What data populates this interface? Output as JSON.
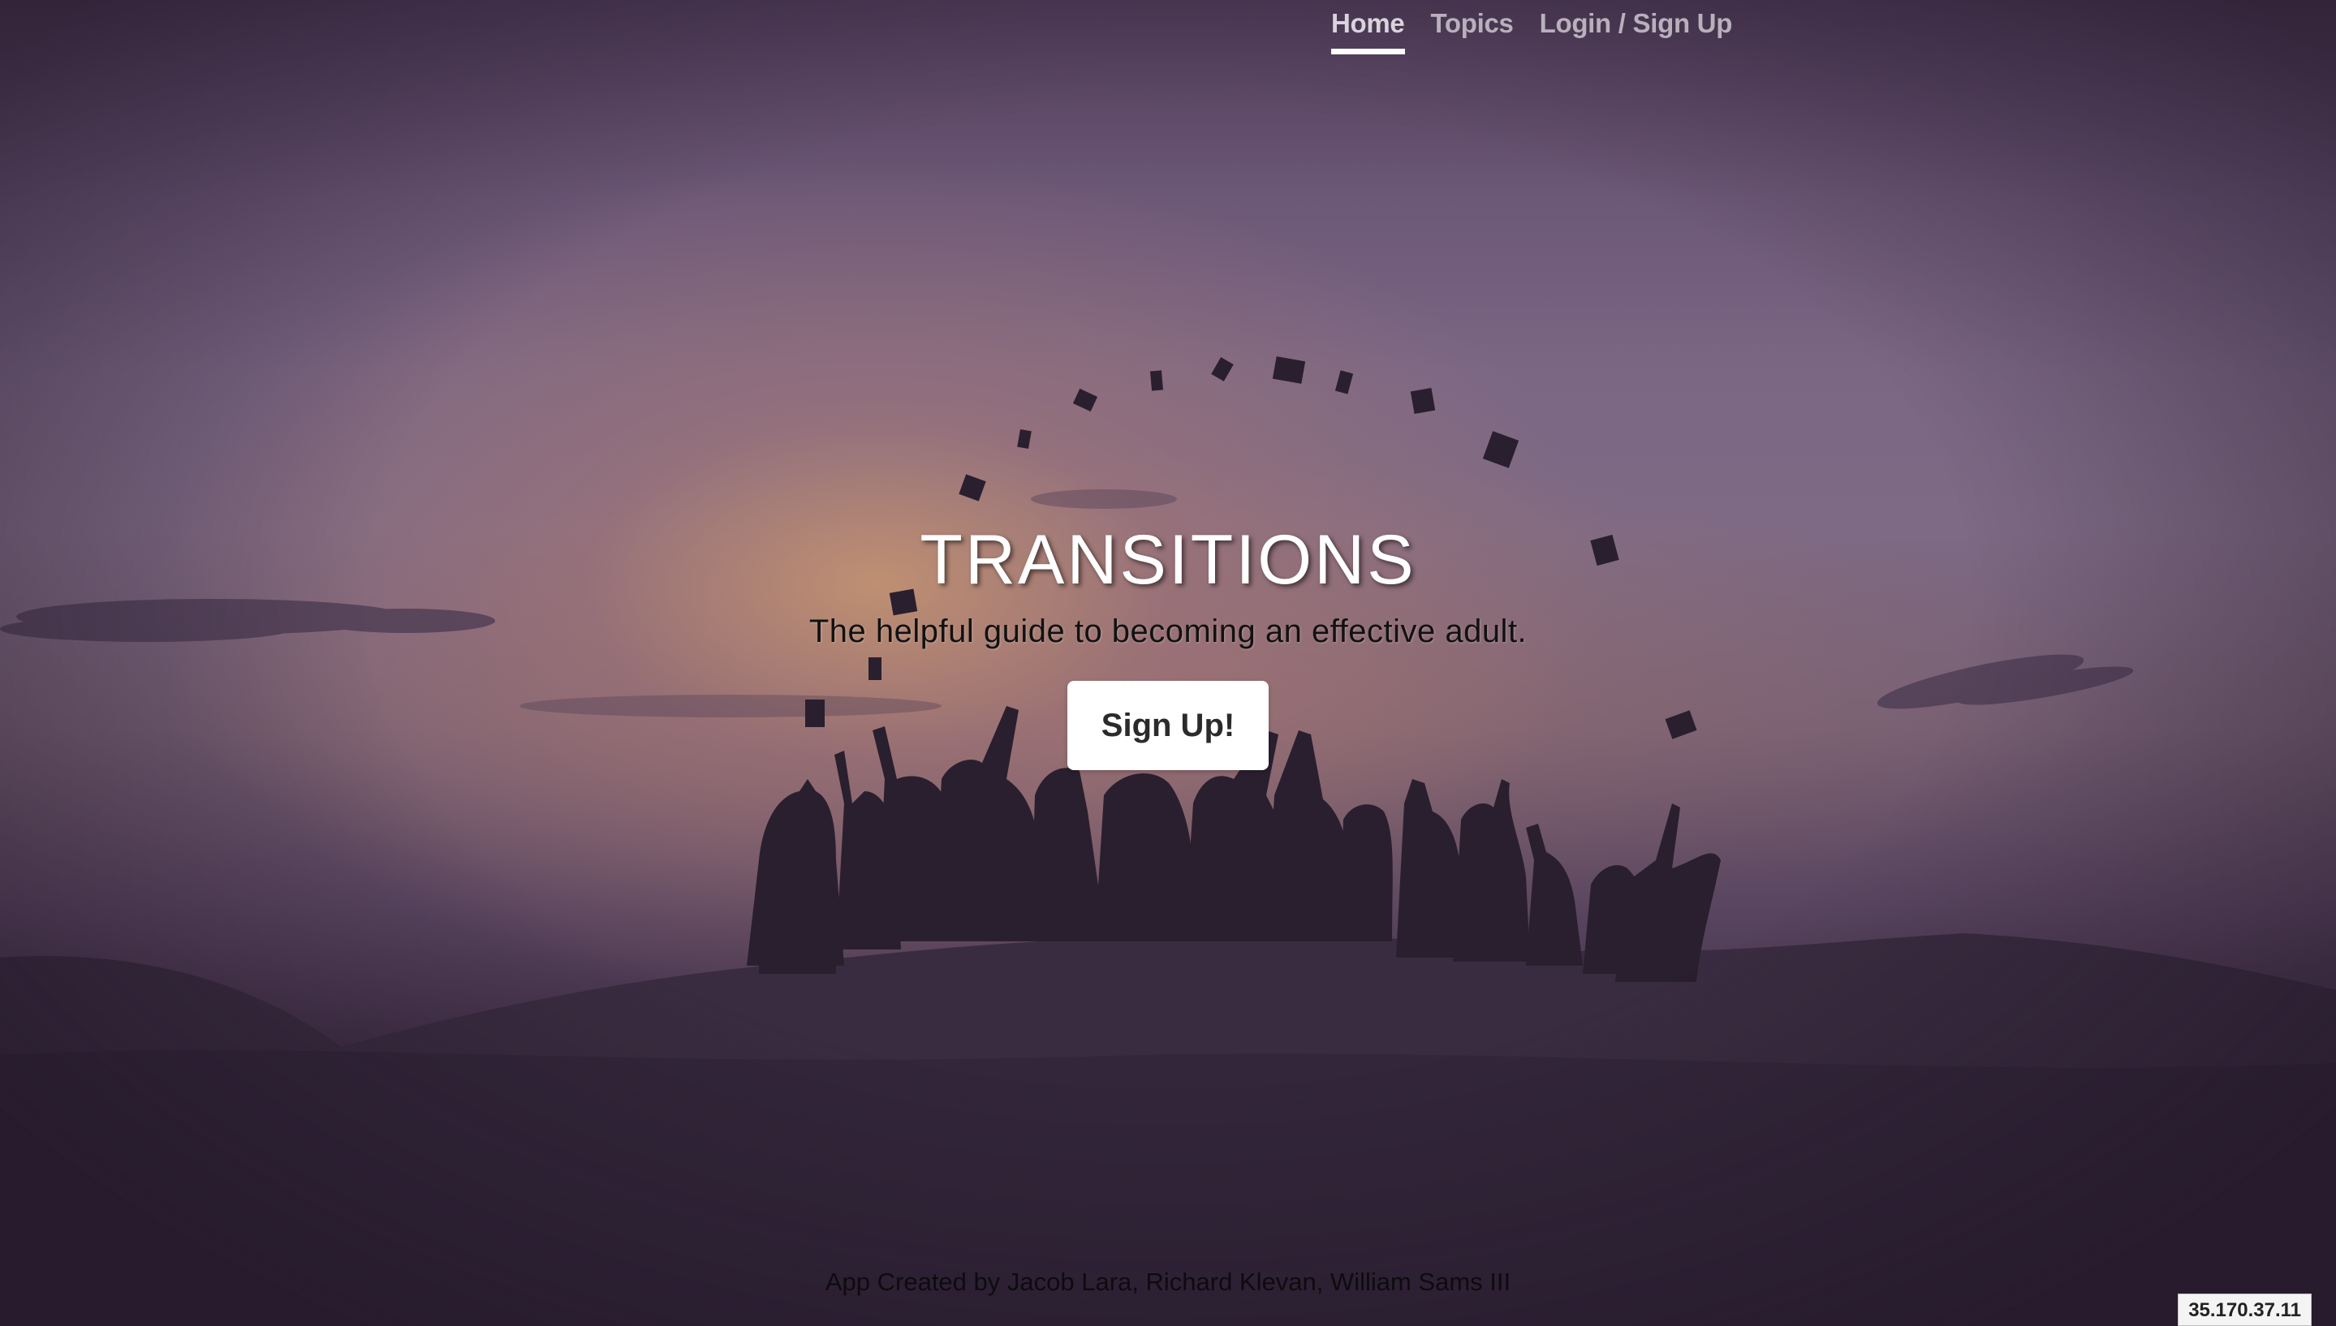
{
  "nav": {
    "items": [
      {
        "label": "Home",
        "active": true
      },
      {
        "label": "Topics",
        "active": false
      },
      {
        "label": "Login / Sign Up",
        "active": false
      }
    ]
  },
  "hero": {
    "title": "TRANSITIONS",
    "subtitle": "The helpful guide to becoming an effective adult.",
    "button_label": "Sign Up!"
  },
  "footer": {
    "credits": "App Created by Jacob Lara, Richard Klevan, William Sams III"
  },
  "overlay": {
    "ip_address": "35.170.37.11"
  },
  "colors": {
    "sky_top": "#4e3b57",
    "sky_mid": "#7b6784",
    "glow": "#c99670",
    "ground": "#34263b",
    "silhouette": "#2a1f2e"
  }
}
